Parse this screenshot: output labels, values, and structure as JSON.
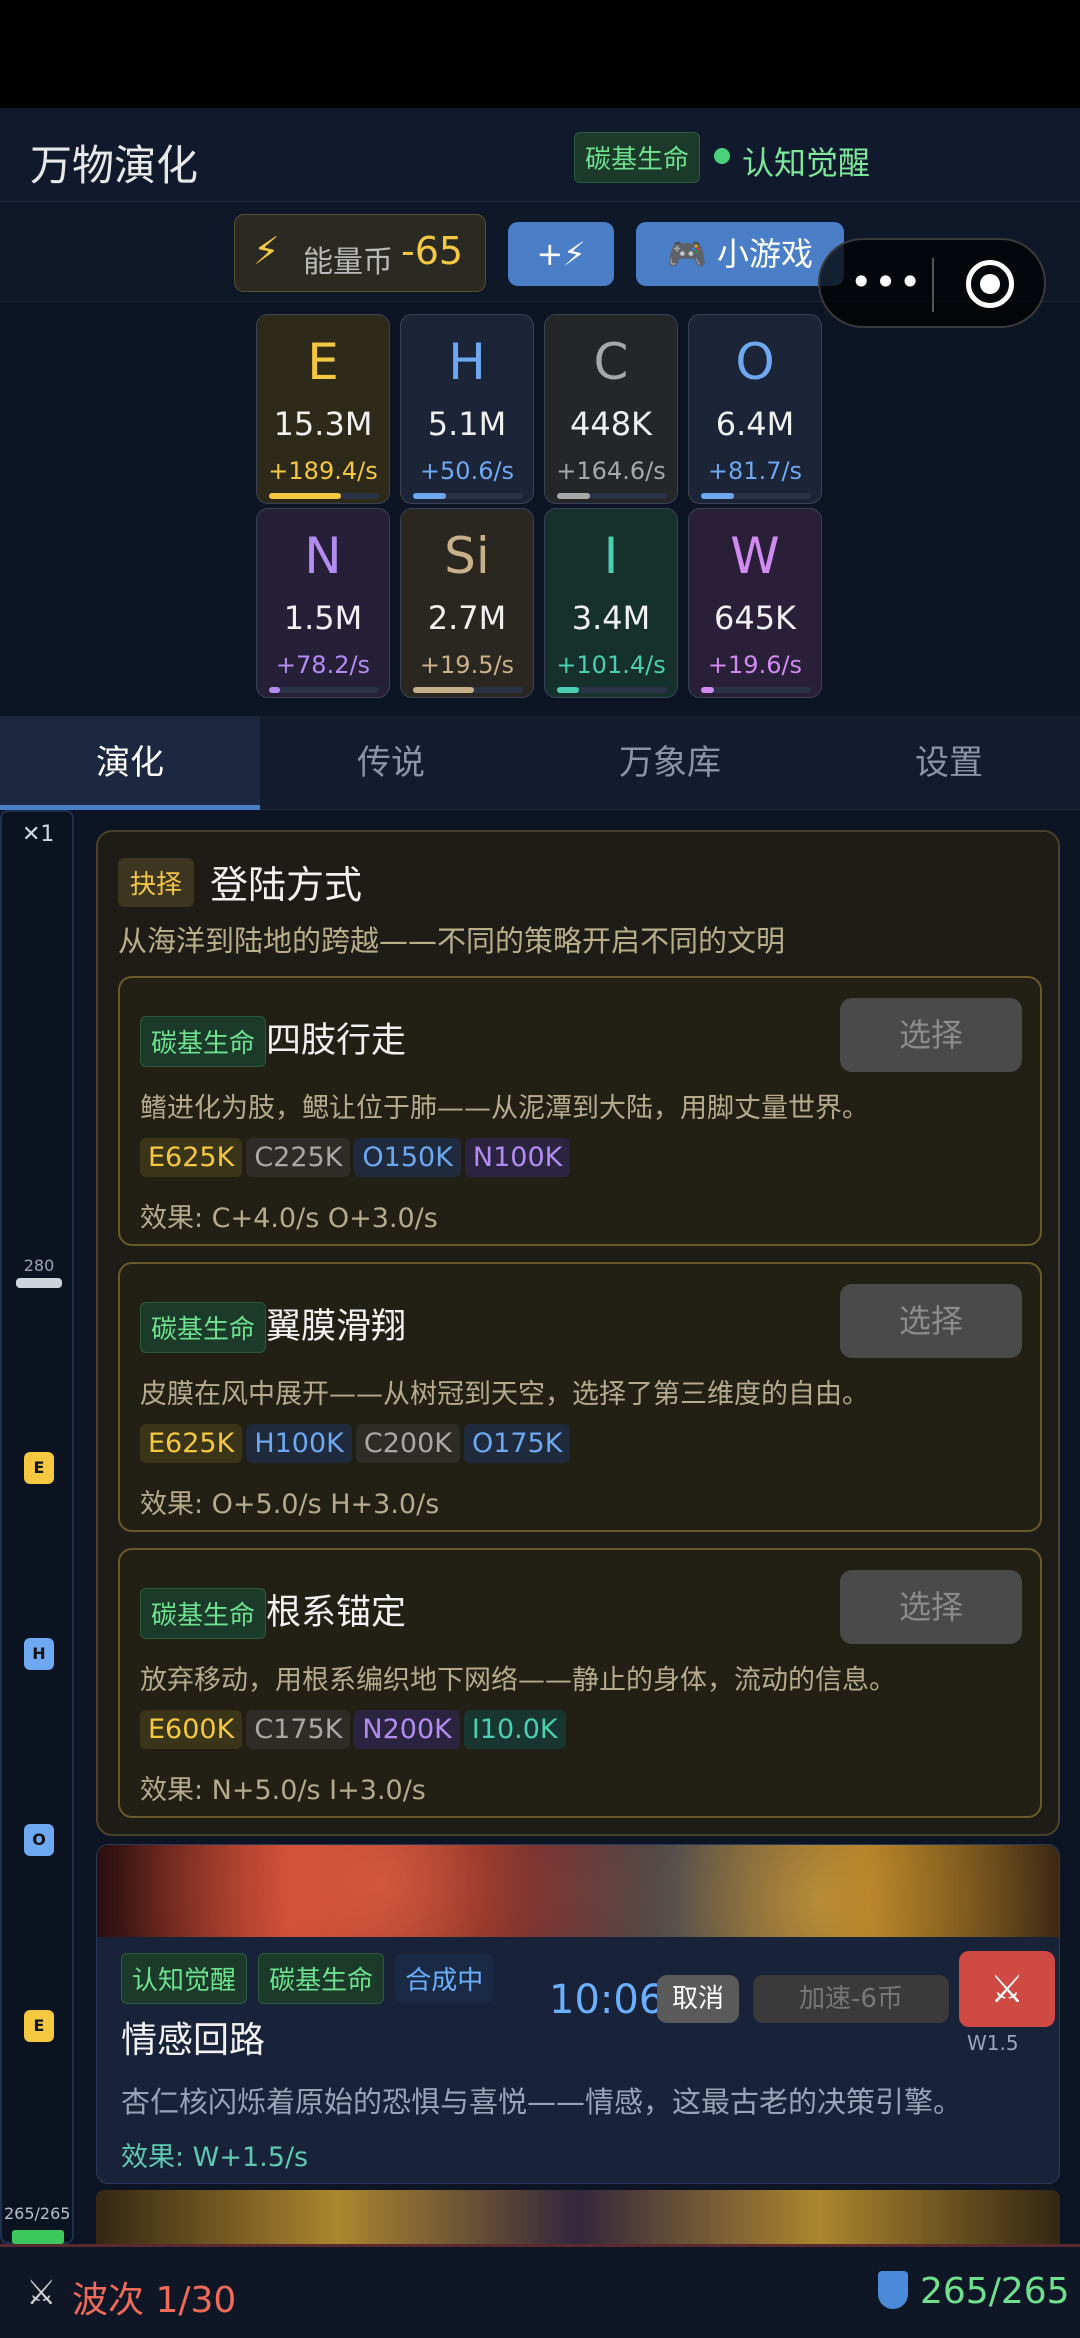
{
  "header": {
    "title": "万物演化",
    "era_tag": "碳基生命",
    "stage_label": "认知觉醒"
  },
  "energy": {
    "label": "能量币",
    "value": "-65",
    "add_button": "+⚡",
    "game_button": "🎮 小游戏"
  },
  "capsule": {
    "more_icon": "•••"
  },
  "resources": [
    {
      "symbol": "E",
      "amount": "15.3M",
      "rate": "+189.4/s",
      "color": "#f5c842",
      "bg": "#2e2a1a",
      "fill": 0.65
    },
    {
      "symbol": "H",
      "amount": "5.1M",
      "rate": "+50.6/s",
      "color": "#6ea8f0",
      "bg": "#1c2438",
      "fill": 0.3
    },
    {
      "symbol": "C",
      "amount": "448K",
      "rate": "+164.6/s",
      "color": "#a8a8a8",
      "bg": "#242628",
      "fill": 0.3
    },
    {
      "symbol": "O",
      "amount": "6.4M",
      "rate": "+81.7/s",
      "color": "#6ea8f0",
      "bg": "#1c2438",
      "fill": 0.3
    },
    {
      "symbol": "N",
      "amount": "1.5M",
      "rate": "+78.2/s",
      "color": "#b38cf0",
      "bg": "#251f38",
      "fill": 0.1
    },
    {
      "symbol": "Si",
      "amount": "2.7M",
      "rate": "+19.5/s",
      "color": "#c8b08a",
      "bg": "#2a2620",
      "fill": 0.55
    },
    {
      "symbol": "I",
      "amount": "3.4M",
      "rate": "+101.4/s",
      "color": "#4ad0b0",
      "bg": "#16302c",
      "fill": 0.2
    },
    {
      "symbol": "W",
      "amount": "645K",
      "rate": "+19.6/s",
      "color": "#d08af0",
      "bg": "#2a1f38",
      "fill": 0.12
    }
  ],
  "tabs": [
    "演化",
    "传说",
    "万象库",
    "设置"
  ],
  "rail": {
    "top_label": "✕1",
    "marker_value": "280",
    "icons": [
      {
        "letter": "E",
        "color": "#f5c842"
      },
      {
        "letter": "H",
        "color": "#6ea8f0"
      },
      {
        "letter": "O",
        "color": "#6ea8f0"
      },
      {
        "letter": "E",
        "color": "#f5c842"
      }
    ],
    "hp_label": "265/265",
    "hp_fraction": 1.0
  },
  "choice": {
    "badge": "抉择",
    "title": "登陆方式",
    "desc": "从海洋到陆地的跨越——不同的策略开启不同的文明",
    "select_label": "选择",
    "options": [
      {
        "tag": "碳基生命",
        "name": "四肢行走",
        "desc": "鳍进化为肢，鳃让位于肺——从泥潭到大陆，用脚丈量世界。",
        "costs": [
          {
            "type": "E",
            "text": "E625K"
          },
          {
            "type": "C",
            "text": "C225K"
          },
          {
            "type": "O",
            "text": "O150K"
          },
          {
            "type": "N",
            "text": "N100K"
          }
        ],
        "effect": "效果: C+4.0/s  O+3.0/s"
      },
      {
        "tag": "碳基生命",
        "name": "翼膜滑翔",
        "desc": "皮膜在风中展开——从树冠到天空，选择了第三维度的自由。",
        "costs": [
          {
            "type": "E",
            "text": "E625K"
          },
          {
            "type": "H",
            "text": "H100K"
          },
          {
            "type": "C",
            "text": "C200K"
          },
          {
            "type": "O",
            "text": "O175K"
          }
        ],
        "effect": "效果: O+5.0/s  H+3.0/s"
      },
      {
        "tag": "碳基生命",
        "name": "根系锚定",
        "desc": "放弃移动，用根系编织地下网络——静止的身体，流动的信息。",
        "costs": [
          {
            "type": "E",
            "text": "E600K"
          },
          {
            "type": "C",
            "text": "C175K"
          },
          {
            "type": "N",
            "text": "N200K"
          },
          {
            "type": "I",
            "text": "I10.0K"
          }
        ],
        "effect": "效果: N+5.0/s  I+3.0/s"
      }
    ]
  },
  "synthesis": {
    "tags": [
      "认知觉醒",
      "碳基生命",
      "合成中"
    ],
    "name": "情感回路",
    "timer": "10:06",
    "cancel": "取消",
    "speedup": "加速-6币",
    "wave_label": "W1.5",
    "desc": "杏仁核闪烁着原始的恐惧与喜悦——情感，这最古老的决策引擎。",
    "effect": "效果: W+1.5/s"
  },
  "bottom": {
    "wave": "波次 1/30",
    "hp": "265/265"
  }
}
